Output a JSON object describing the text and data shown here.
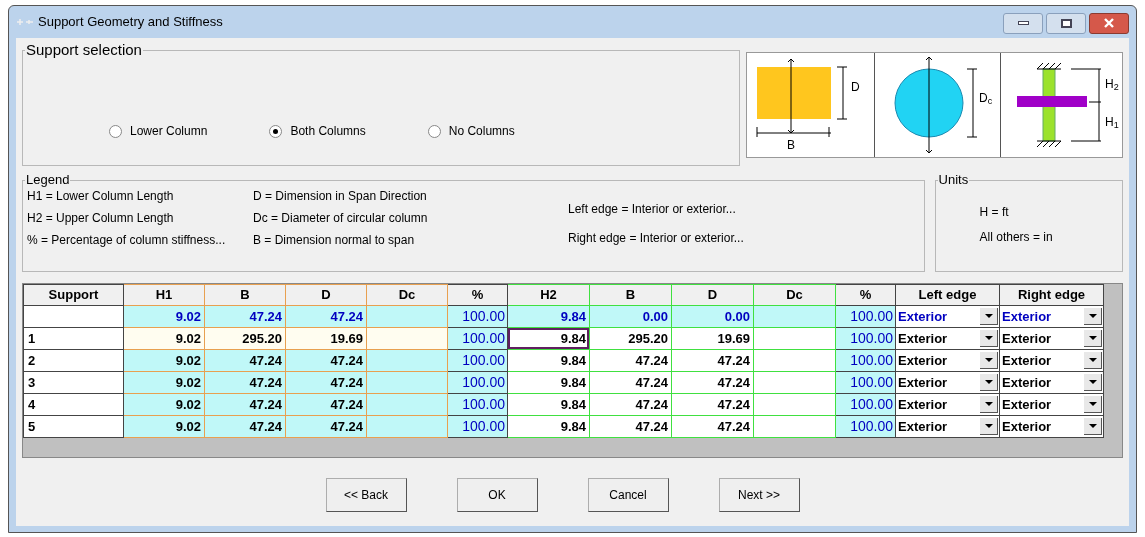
{
  "window": {
    "title": "Support Geometry and Stiffness"
  },
  "support_selection": {
    "title": "Support selection",
    "options": [
      {
        "label": "Lower Column",
        "selected": false
      },
      {
        "label": "Both Columns",
        "selected": true
      },
      {
        "label": "No Columns",
        "selected": false
      }
    ]
  },
  "diagram_labels": {
    "rect_depth": "D",
    "rect_width": "B",
    "circle_diameter": "D$_{c}$",
    "upper_height": "H$_{2}$",
    "lower_height": "H$_{1}$"
  },
  "legend": {
    "title": "Legend",
    "columns": [
      [
        "H1 = Lower Column Length",
        "H2 = Upper Column Length",
        "% = Percentage of column stiffness..."
      ],
      [
        "D = Dimension in Span Direction",
        "Dc = Diameter of circular column",
        "B = Dimension normal to span"
      ],
      [
        "Left edge = Interior or exterior...",
        "Right edge = Interior or exterior..."
      ]
    ]
  },
  "units": {
    "title": "Units",
    "lines": [
      "H = ft",
      "All others = in"
    ]
  },
  "table": {
    "columns": [
      {
        "label": "Support",
        "kind": "label"
      },
      {
        "label": "H1",
        "kind": "lower"
      },
      {
        "label": "B",
        "kind": "lower"
      },
      {
        "label": "D",
        "kind": "lower"
      },
      {
        "label": "Dc",
        "kind": "lower"
      },
      {
        "label": "%",
        "kind": "pct"
      },
      {
        "label": "H2",
        "kind": "upper"
      },
      {
        "label": "B",
        "kind": "upper"
      },
      {
        "label": "D",
        "kind": "upper"
      },
      {
        "label": "Dc",
        "kind": "upper"
      },
      {
        "label": "%",
        "kind": "pct"
      },
      {
        "label": "Left edge",
        "kind": "edge"
      },
      {
        "label": "Right edge",
        "kind": "edge"
      }
    ],
    "rows": [
      {
        "kind": "default",
        "current": false,
        "cells": [
          {
            "selected": false
          },
          {
            "text": "9.02",
            "selected": false
          },
          {
            "text": "47.24",
            "selected": false
          },
          {
            "text": "47.24",
            "selected": false
          },
          {
            "selected": false
          },
          {
            "text": "100.00",
            "selected": false
          },
          {
            "text": "9.84",
            "selected": false
          },
          {
            "text": "0.00",
            "selected": false
          },
          {
            "text": "0.00",
            "selected": false
          },
          {
            "selected": false
          },
          {
            "text": "100.00",
            "selected": false
          },
          {
            "text": "Exterior",
            "selected": false
          },
          {
            "text": "Exterior",
            "selected": false
          }
        ]
      },
      {
        "kind": "support",
        "current": true,
        "cells": [
          {
            "text": "1",
            "selected": false
          },
          {
            "text": "9.02",
            "selected": false
          },
          {
            "text": "295.20",
            "selected": false
          },
          {
            "text": "19.69",
            "selected": false
          },
          {
            "selected": false
          },
          {
            "text": "100.00",
            "selected": false
          },
          {
            "text": "9.84",
            "selected": true
          },
          {
            "text": "295.20",
            "selected": false
          },
          {
            "text": "19.69",
            "selected": false
          },
          {
            "selected": false
          },
          {
            "text": "100.00",
            "selected": false
          },
          {
            "text": "Exterior",
            "selected": false
          },
          {
            "text": "Exterior",
            "selected": false
          }
        ]
      },
      {
        "kind": "support",
        "current": false,
        "cells": [
          {
            "text": "2",
            "selected": false
          },
          {
            "text": "9.02",
            "selected": false
          },
          {
            "text": "47.24",
            "selected": false
          },
          {
            "text": "47.24",
            "selected": false
          },
          {
            "selected": false
          },
          {
            "text": "100.00",
            "selected": false
          },
          {
            "text": "9.84",
            "selected": false
          },
          {
            "text": "47.24",
            "selected": false
          },
          {
            "text": "47.24",
            "selected": false
          },
          {
            "selected": false
          },
          {
            "text": "100.00",
            "selected": false
          },
          {
            "text": "Exterior",
            "selected": false
          },
          {
            "text": "Exterior",
            "selected": false
          }
        ]
      },
      {
        "kind": "support",
        "current": false,
        "cells": [
          {
            "text": "3",
            "selected": false
          },
          {
            "text": "9.02",
            "selected": false
          },
          {
            "text": "47.24",
            "selected": false
          },
          {
            "text": "47.24",
            "selected": false
          },
          {
            "selected": false
          },
          {
            "text": "100.00",
            "selected": false
          },
          {
            "text": "9.84",
            "selected": false
          },
          {
            "text": "47.24",
            "selected": false
          },
          {
            "text": "47.24",
            "selected": false
          },
          {
            "selected": false
          },
          {
            "text": "100.00",
            "selected": false
          },
          {
            "text": "Exterior",
            "selected": false
          },
          {
            "text": "Exterior",
            "selected": false
          }
        ]
      },
      {
        "kind": "support",
        "current": false,
        "cells": [
          {
            "text": "4",
            "selected": false
          },
          {
            "text": "9.02",
            "selected": false
          },
          {
            "text": "47.24",
            "selected": false
          },
          {
            "text": "47.24",
            "selected": false
          },
          {
            "selected": false
          },
          {
            "text": "100.00",
            "selected": false
          },
          {
            "text": "9.84",
            "selected": false
          },
          {
            "text": "47.24",
            "selected": false
          },
          {
            "text": "47.24",
            "selected": false
          },
          {
            "selected": false
          },
          {
            "text": "100.00",
            "selected": false
          },
          {
            "text": "Exterior",
            "selected": false
          },
          {
            "text": "Exterior",
            "selected": false
          }
        ]
      },
      {
        "kind": "support",
        "current": false,
        "cells": [
          {
            "text": "5",
            "selected": false
          },
          {
            "text": "9.02",
            "selected": false
          },
          {
            "text": "47.24",
            "selected": false
          },
          {
            "text": "47.24",
            "selected": false
          },
          {
            "selected": false
          },
          {
            "text": "100.00",
            "selected": false
          },
          {
            "text": "9.84",
            "selected": false
          },
          {
            "text": "47.24",
            "selected": false
          },
          {
            "text": "47.24",
            "selected": false
          },
          {
            "selected": false
          },
          {
            "text": "100.00",
            "selected": false
          },
          {
            "text": "Exterior",
            "selected": false
          },
          {
            "text": "Exterior",
            "selected": false
          }
        ]
      }
    ]
  },
  "buttons": [
    "<< Back",
    "OK",
    "Cancel",
    "Next >>"
  ]
}
